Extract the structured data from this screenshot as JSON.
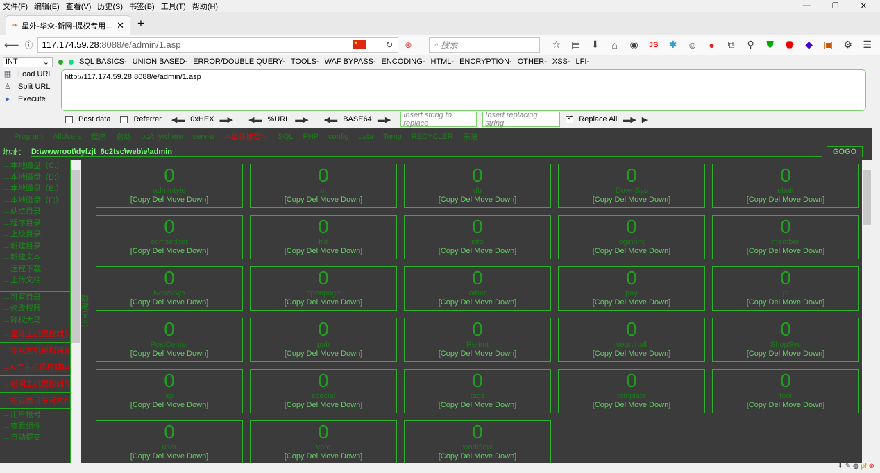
{
  "menubar": [
    "文件(F)",
    "编辑(E)",
    "查看(V)",
    "历史(S)",
    "书签(B)",
    "工具(T)",
    "帮助(H)"
  ],
  "tab": {
    "title": "星外-华众-新网-提权专用...",
    "close": "✕",
    "new": "+"
  },
  "url": {
    "host": "117.174.59.28",
    "path": ":8088/e/admin/1.asp"
  },
  "search": {
    "placeholder": "搜索"
  },
  "hackbar": {
    "select": "INT",
    "menus": [
      "SQL BASICS-",
      "UNION BASED-",
      "ERROR/DOUBLE QUERY-",
      "TOOLS-",
      "WAF BYPASS-",
      "ENCODING-",
      "HTML-",
      "ENCRYPTION-",
      "OTHER-",
      "XSS-",
      "LFI-"
    ],
    "load": "Load URL",
    "split": "Split URL",
    "execute": "Execute",
    "textarea": "http://117.174.59.28:8088/e/admin/1.asp",
    "post": "Post data",
    "referrer": "Referrer",
    "hex": "0xHEX",
    "url": "%URL",
    "base64": "BASE64",
    "insert_placeholder": "Insert string to replace",
    "replacing_placeholder": "Insert replacing string",
    "replace_all": "Replace All"
  },
  "toplinks": [
    {
      "text": "Program",
      "red": false
    },
    {
      "text": "AllUsers",
      "red": false
    },
    {
      "text": "程序",
      "red": false
    },
    {
      "text": "启动",
      "red": false
    },
    {
      "text": "pcAnywhere",
      "red": false
    },
    {
      "text": "serv-u",
      "red": false
    },
    {
      "text": "-=星外接写=-",
      "red": true
    },
    {
      "text": "SQL",
      "red": false
    },
    {
      "text": "PHP",
      "red": false
    },
    {
      "text": "config",
      "red": false
    },
    {
      "text": "data",
      "red": false
    },
    {
      "text": "Temp",
      "red": false
    },
    {
      "text": "RECYCLER",
      "red": false
    },
    {
      "text": "乐陪",
      "red": false
    }
  ],
  "address": {
    "label": "地址：",
    "value": "D:\\wwwroot\\dyfzjt_6c2tsc\\web\\e\\admin",
    "button": "GOGO"
  },
  "sidebar": [
    {
      "t": "→本地磁盘（C:）",
      "k": "n"
    },
    {
      "t": "→本地磁盘（D:）",
      "k": "n"
    },
    {
      "t": "→本地磁盘（E:）",
      "k": "n"
    },
    {
      "t": "→本地磁盘（F:）",
      "k": "n"
    },
    {
      "t": "→站点目录",
      "k": "n"
    },
    {
      "t": "→程序目录",
      "k": "n"
    },
    {
      "t": "→上级目录",
      "k": "n"
    },
    {
      "t": "→新建目录",
      "k": "n"
    },
    {
      "t": "→新建文本",
      "k": "n"
    },
    {
      "t": "→远程下载",
      "k": "n"
    },
    {
      "t": "→上传文档",
      "k": "n"
    },
    {
      "t": "",
      "k": "g"
    },
    {
      "t": "→可写目录",
      "k": "n"
    },
    {
      "t": "→修改权限",
      "k": "n"
    },
    {
      "t": "→降权大马",
      "k": "n"
    },
    {
      "t": "→星外主机提权辅助",
      "k": "r"
    },
    {
      "t": "→华众主机提权辅助",
      "k": "r"
    },
    {
      "t": "→N点主机提权辅助",
      "k": "r"
    },
    {
      "t": "→新网主机提权辅助",
      "k": "r"
    },
    {
      "t": "→扫目录可写可执行版",
      "k": "r"
    },
    {
      "t": "→用户帐号",
      "k": "n"
    },
    {
      "t": "→查看组件",
      "k": "n"
    },
    {
      "t": "→自动提交",
      "k": "n"
    }
  ],
  "vtext": "隐藏显示",
  "folders": [
    {
      "count": "0",
      "name": "admintyle"
    },
    {
      "count": "0",
      "name": "cj"
    },
    {
      "count": "0",
      "name": "db"
    },
    {
      "count": "0",
      "name": "DownSys"
    },
    {
      "count": "0",
      "name": "ebak"
    },
    {
      "count": "0",
      "name": "ecmseditor"
    },
    {
      "count": "0",
      "name": "file"
    },
    {
      "count": "0",
      "name": "info"
    },
    {
      "count": "0",
      "name": "loginnng"
    },
    {
      "count": "0",
      "name": "member"
    },
    {
      "count": "0",
      "name": "NewsSys"
    },
    {
      "count": "0",
      "name": "openpage"
    },
    {
      "count": "0",
      "name": "other"
    },
    {
      "count": "0",
      "name": "pay"
    },
    {
      "count": "0",
      "name": "pl"
    },
    {
      "count": "0",
      "name": "PostCenter"
    },
    {
      "count": "0",
      "name": "pub"
    },
    {
      "count": "0",
      "name": "Rettmt"
    },
    {
      "count": "0",
      "name": "searchall"
    },
    {
      "count": "0",
      "name": "ShopSys"
    },
    {
      "count": "0",
      "name": "sp"
    },
    {
      "count": "0",
      "name": "special"
    },
    {
      "count": "0",
      "name": "tags"
    },
    {
      "count": "0",
      "name": "template"
    },
    {
      "count": "0",
      "name": "tool"
    },
    {
      "count": "0",
      "name": "user"
    },
    {
      "count": "0",
      "name": "vote"
    },
    {
      "count": "0",
      "name": "workflow"
    }
  ],
  "folder_actions": "[Copy Del Move Down]"
}
